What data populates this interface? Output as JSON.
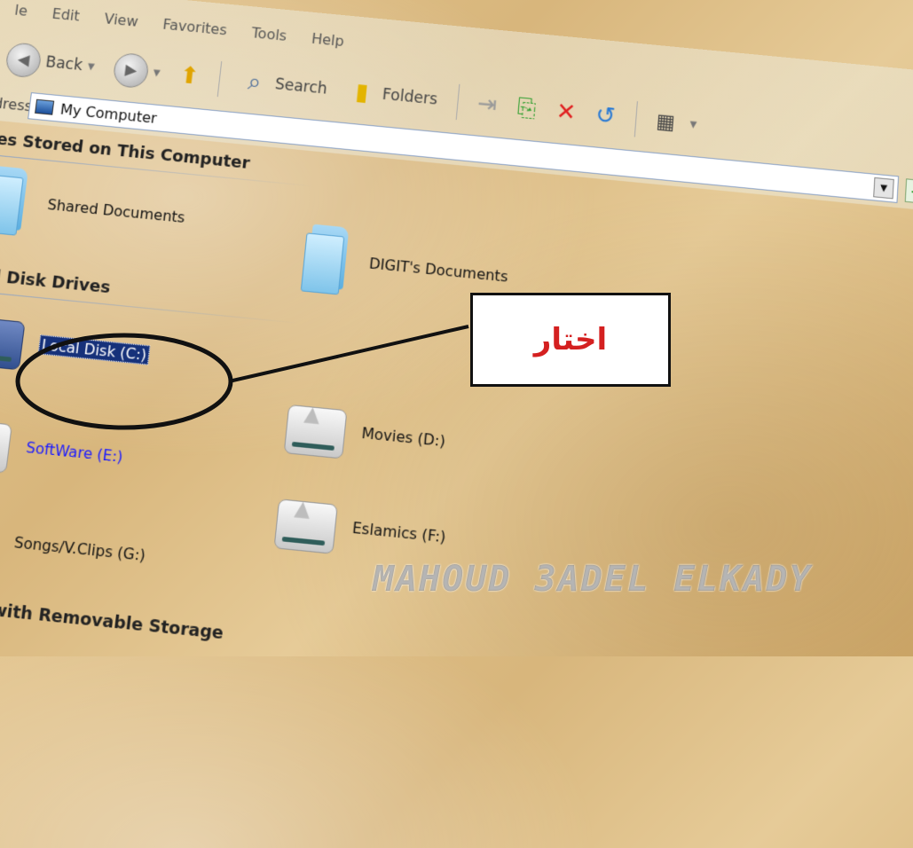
{
  "menu": [
    "le",
    "Edit",
    "View",
    "Favorites",
    "Tools",
    "Help"
  ],
  "toolbar": {
    "back": "Back",
    "search": "Search",
    "folders": "Folders"
  },
  "address": {
    "label": "ddress",
    "value": "My Computer",
    "go": "Go"
  },
  "groups": {
    "stored": "Files Stored on This Computer",
    "hdd": "Hard Disk Drives",
    "removable": "Devices with Removable Storage"
  },
  "items": {
    "shared": "Shared Documents",
    "mydocs": "DIGIT's Documents",
    "c": "Local Disk (C:)",
    "d": "Movies (D:)",
    "e": "SoftWare (E:)",
    "f": "Eslamics (F:)",
    "g": "Songs/V.Clips (G:)"
  },
  "callout": "اختار",
  "watermark": "MAHOUD 3ADEL ELKADY",
  "colors": {
    "callout_text": "#d42020",
    "selection": "#16317a",
    "link_blue": "#1a1aff"
  }
}
